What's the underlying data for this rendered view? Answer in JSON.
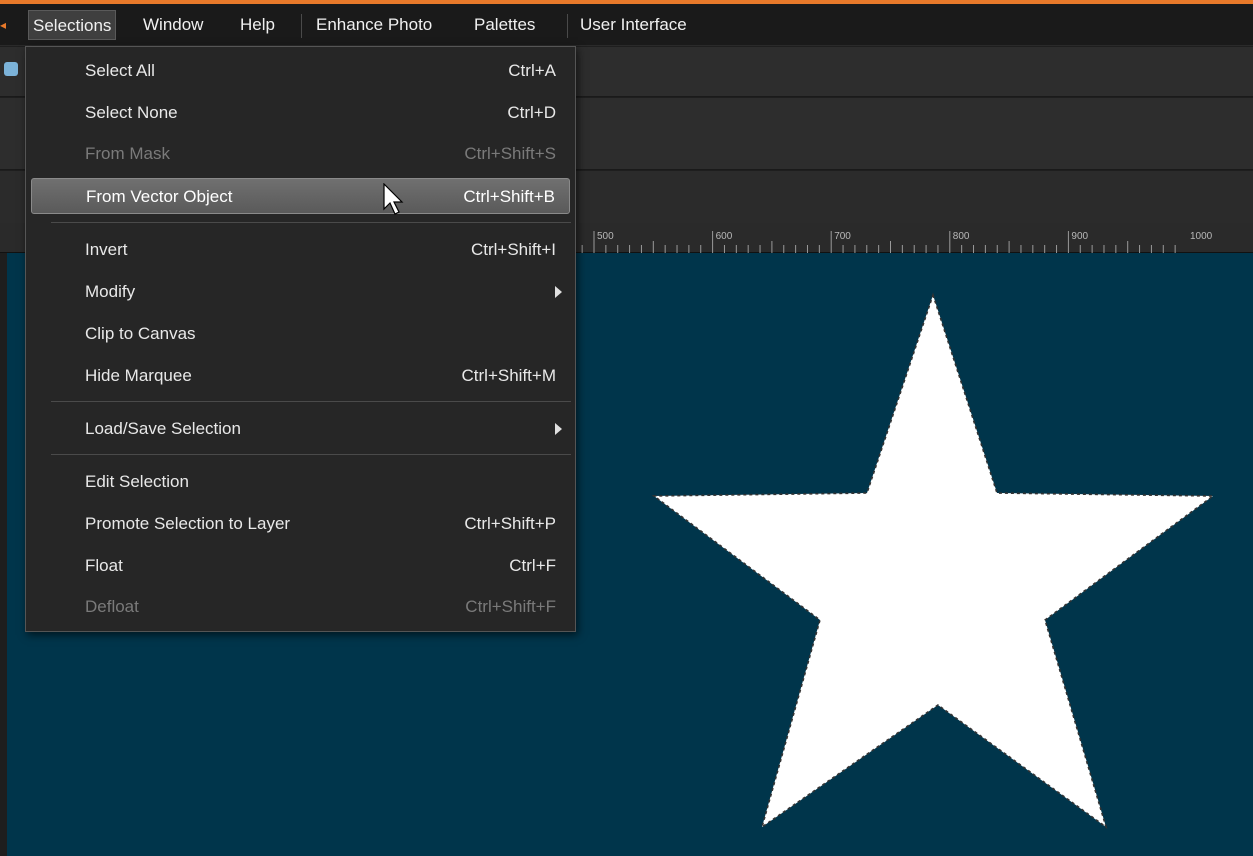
{
  "menubar": {
    "items": [
      {
        "label": "Selections",
        "open": true
      },
      {
        "label": "Window"
      },
      {
        "label": "Help"
      },
      {
        "label": "Enhance Photo"
      },
      {
        "label": "Palettes"
      },
      {
        "label": "User Interface"
      }
    ]
  },
  "ruler": {
    "ticks": [
      "500",
      "600",
      "700",
      "800",
      "900",
      "1000"
    ]
  },
  "menu": {
    "items": [
      {
        "label": "Select All",
        "shortcut": "Ctrl+A",
        "state": "enabled"
      },
      {
        "label": "Select None",
        "shortcut": "Ctrl+D",
        "state": "enabled"
      },
      {
        "label": "From Mask",
        "shortcut": "Ctrl+Shift+S",
        "state": "disabled"
      },
      {
        "label": "From Vector Object",
        "shortcut": "Ctrl+Shift+B",
        "state": "hover"
      },
      {
        "label": "Invert",
        "shortcut": "Ctrl+Shift+I",
        "state": "enabled"
      },
      {
        "label": "Modify",
        "shortcut": "",
        "state": "submenu"
      },
      {
        "label": "Clip to Canvas",
        "shortcut": "",
        "state": "enabled"
      },
      {
        "label": "Hide Marquee",
        "shortcut": "Ctrl+Shift+M",
        "state": "enabled"
      },
      {
        "label": "Load/Save Selection",
        "shortcut": "",
        "state": "submenu"
      },
      {
        "label": "Edit Selection",
        "shortcut": "",
        "state": "enabled"
      },
      {
        "label": "Promote Selection to Layer",
        "shortcut": "Ctrl+Shift+P",
        "state": "enabled"
      },
      {
        "label": "Float",
        "shortcut": "Ctrl+F",
        "state": "enabled"
      },
      {
        "label": "Defloat",
        "shortcut": "Ctrl+Shift+F",
        "state": "disabled"
      }
    ]
  },
  "colors": {
    "accent": "#e8792a",
    "canvas_bg": "#00354b",
    "shape_fill": "#ffffff"
  },
  "icons": [
    "arrow-left-icon",
    "tool-icon",
    "submenu-arrow-icon",
    "mouse-pointer-icon"
  ]
}
